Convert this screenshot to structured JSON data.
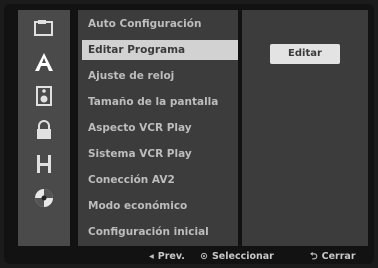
{
  "sidebar": {
    "icons": [
      {
        "name": "disc-folder-icon"
      },
      {
        "name": "letter-a-icon"
      },
      {
        "name": "speaker-icon"
      },
      {
        "name": "lock-icon"
      },
      {
        "name": "setup-bracket-icon"
      },
      {
        "name": "disc-icon"
      }
    ]
  },
  "menu": {
    "items": [
      {
        "label": "Auto Configuración"
      },
      {
        "label": "Editar Programa"
      },
      {
        "label": "Ajuste de reloj"
      },
      {
        "label": "Tamaño de la pantalla"
      },
      {
        "label": "Aspecto VCR Play"
      },
      {
        "label": "Sistema VCR Play"
      },
      {
        "label": "Conección AV2"
      },
      {
        "label": "Modo económico"
      },
      {
        "label": "Configuración inicial"
      }
    ],
    "selected_index": 1
  },
  "detail": {
    "button_label": "Editar"
  },
  "footer": {
    "prev_symbol": "◂",
    "prev_label": "Prev.",
    "select_symbol": "⊙",
    "select_label": "Seleccionar",
    "close_symbol": "⮌",
    "close_label": "Cerrar"
  },
  "colors": {
    "highlight": "#d2d2d2",
    "panel": "#3c3c3c",
    "icon_bar": "#4a4a4a"
  }
}
